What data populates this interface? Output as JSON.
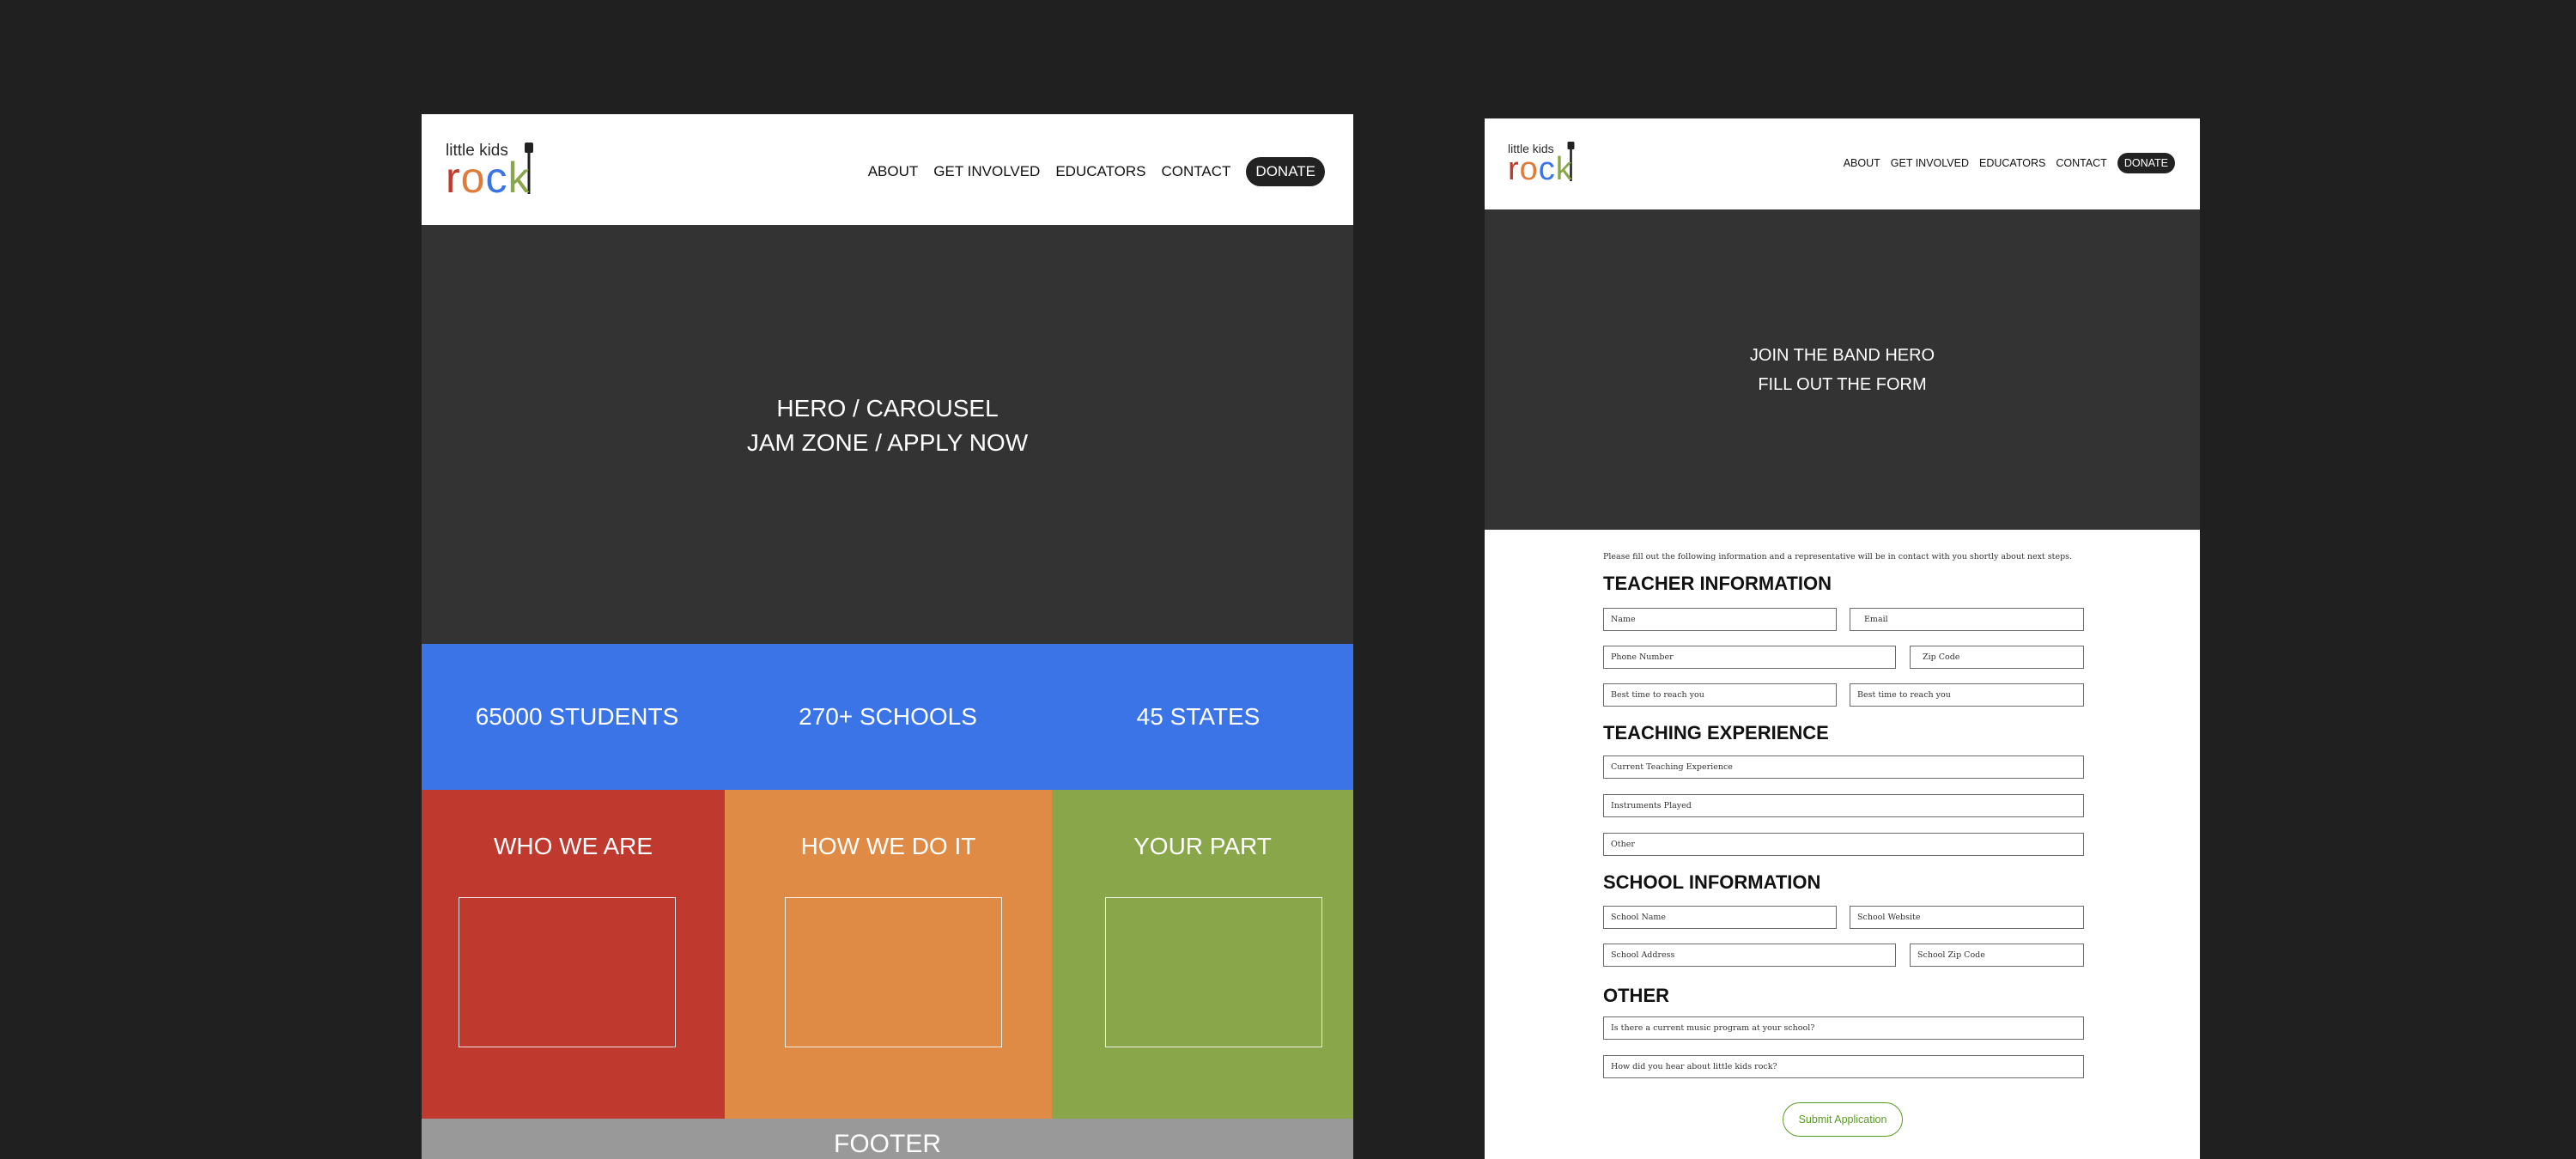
{
  "colors": {
    "background": "#202020",
    "hero": "#333333",
    "stats": "#3b74e6",
    "card_red": "#c0392e",
    "card_orange": "#df8b45",
    "card_green": "#89a74a",
    "footer": "#999999",
    "submit_green": "#5b9a24",
    "logo_r": "#c0392e",
    "logo_o": "#e07b39",
    "logo_c": "#3b74e6",
    "logo_k": "#89a74a"
  },
  "logo": {
    "small_text": "little kids",
    "letters": [
      "r",
      "o",
      "c",
      "k"
    ]
  },
  "nav": {
    "items": [
      "ABOUT",
      "GET INVOLVED",
      "EDUCATORS",
      "CONTACT"
    ],
    "donate": "DONATE"
  },
  "home": {
    "hero": {
      "line1": "HERO / CAROUSEL",
      "line2": "JAM ZONE / APPLY NOW"
    },
    "stats": [
      "65000 STUDENTS",
      "270+ SCHOOLS",
      "45 STATES"
    ],
    "cards": [
      "WHO WE ARE",
      "HOW WE DO IT",
      "YOUR PART"
    ],
    "footer": "FOOTER"
  },
  "form_page": {
    "hero": {
      "line1": "JOIN THE BAND HERO",
      "line2": "FILL OUT THE FORM"
    },
    "intro": "Please fill out the following information and a representative will be in contact with you shortly about next steps.",
    "sections": {
      "teacher": "TEACHER INFORMATION",
      "experience": "TEACHING EXPERIENCE",
      "school": "SCHOOL INFORMATION",
      "other": "OTHER"
    },
    "fields": {
      "name": "Name",
      "email": "Email",
      "phone": "Phone Number",
      "zip": "Zip Code",
      "best_time_1": "Best time to reach you",
      "best_time_2": "Best time to reach you",
      "current_experience": "Current Teaching Experience",
      "instruments": "Instruments Played",
      "other": "Other",
      "school_name": "School Name",
      "school_website": "School Website",
      "school_address": "School Address",
      "school_zip": "School Zip Code",
      "music_program": "Is there a current music program at your school?",
      "heard_about": "How did you hear about little kids rock?"
    },
    "submit": "Submit Application"
  }
}
